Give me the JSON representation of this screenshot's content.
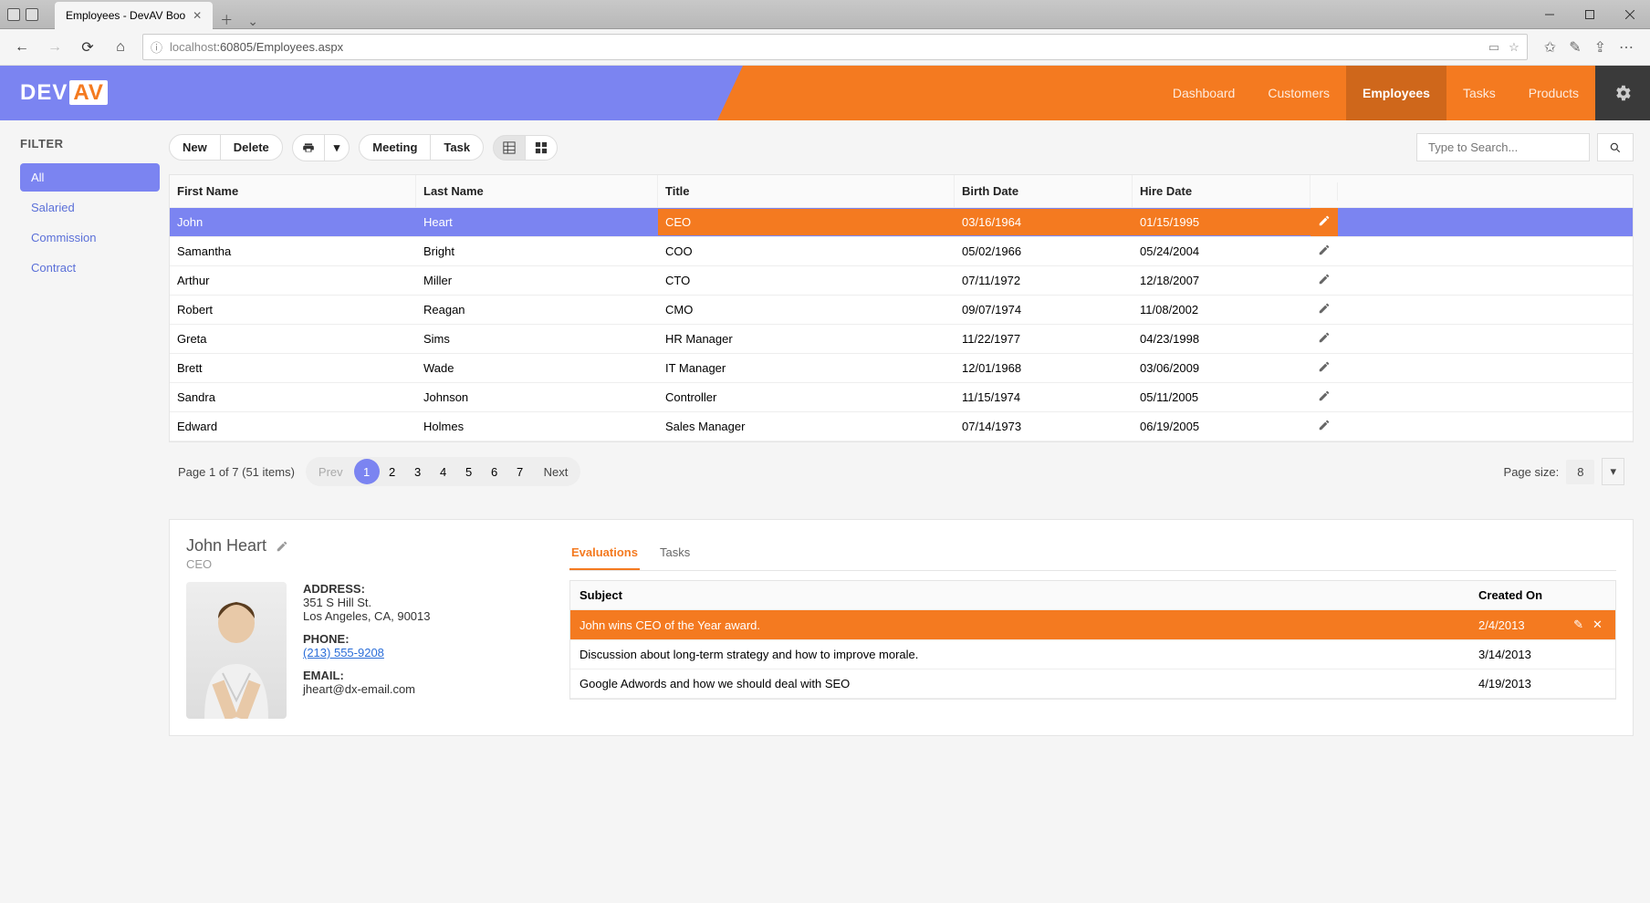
{
  "browser": {
    "tab_title": "Employees - DevAV Boo",
    "url_host": "localhost",
    "url_port_path": ":60805/Employees.aspx"
  },
  "header": {
    "logo_text": "DEV",
    "logo_av": "AV",
    "nav": [
      {
        "label": "Dashboard",
        "active": false
      },
      {
        "label": "Customers",
        "active": false
      },
      {
        "label": "Employees",
        "active": true
      },
      {
        "label": "Tasks",
        "active": false
      },
      {
        "label": "Products",
        "active": false
      }
    ]
  },
  "sidebar": {
    "title": "FILTER",
    "items": [
      {
        "label": "All",
        "active": true
      },
      {
        "label": "Salaried",
        "active": false
      },
      {
        "label": "Commission",
        "active": false
      },
      {
        "label": "Contract",
        "active": false
      }
    ]
  },
  "toolbar": {
    "new": "New",
    "delete": "Delete",
    "meeting": "Meeting",
    "task": "Task",
    "search_placeholder": "Type to Search..."
  },
  "grid": {
    "columns": [
      "First Name",
      "Last Name",
      "Title",
      "Birth Date",
      "Hire Date"
    ],
    "rows": [
      {
        "first": "John",
        "last": "Heart",
        "title": "CEO",
        "birth": "03/16/1964",
        "hire": "01/15/1995",
        "selected": true
      },
      {
        "first": "Samantha",
        "last": "Bright",
        "title": "COO",
        "birth": "05/02/1966",
        "hire": "05/24/2004"
      },
      {
        "first": "Arthur",
        "last": "Miller",
        "title": "CTO",
        "birth": "07/11/1972",
        "hire": "12/18/2007"
      },
      {
        "first": "Robert",
        "last": "Reagan",
        "title": "CMO",
        "birth": "09/07/1974",
        "hire": "11/08/2002"
      },
      {
        "first": "Greta",
        "last": "Sims",
        "title": "HR Manager",
        "birth": "11/22/1977",
        "hire": "04/23/1998"
      },
      {
        "first": "Brett",
        "last": "Wade",
        "title": "IT Manager",
        "birth": "12/01/1968",
        "hire": "03/06/2009"
      },
      {
        "first": "Sandra",
        "last": "Johnson",
        "title": "Controller",
        "birth": "11/15/1974",
        "hire": "05/11/2005"
      },
      {
        "first": "Edward",
        "last": "Holmes",
        "title": "Sales Manager",
        "birth": "07/14/1973",
        "hire": "06/19/2005"
      }
    ]
  },
  "pager": {
    "info": "Page 1 of 7 (51 items)",
    "prev": "Prev",
    "next": "Next",
    "pages": [
      "1",
      "2",
      "3",
      "4",
      "5",
      "6",
      "7"
    ],
    "page_size_label": "Page size:",
    "page_size": "8"
  },
  "detail": {
    "name": "John Heart",
    "title": "CEO",
    "address_label": "ADDRESS:",
    "address_line1": "351 S Hill St.",
    "address_line2": "Los Angeles, CA, 90013",
    "phone_label": "PHONE:",
    "phone": "(213) 555-9208",
    "email_label": "EMAIL:",
    "email": "jheart@dx-email.com",
    "tabs": [
      {
        "label": "Evaluations",
        "active": true
      },
      {
        "label": "Tasks",
        "active": false
      }
    ],
    "eval_columns": [
      "Subject",
      "Created On"
    ],
    "eval_rows": [
      {
        "subject": "John wins CEO of the Year award.",
        "date": "2/4/2013",
        "selected": true
      },
      {
        "subject": "Discussion about long-term strategy and how to improve morale.",
        "date": "3/14/2013"
      },
      {
        "subject": "Google Adwords and how we should deal with SEO",
        "date": "4/19/2013"
      }
    ]
  }
}
